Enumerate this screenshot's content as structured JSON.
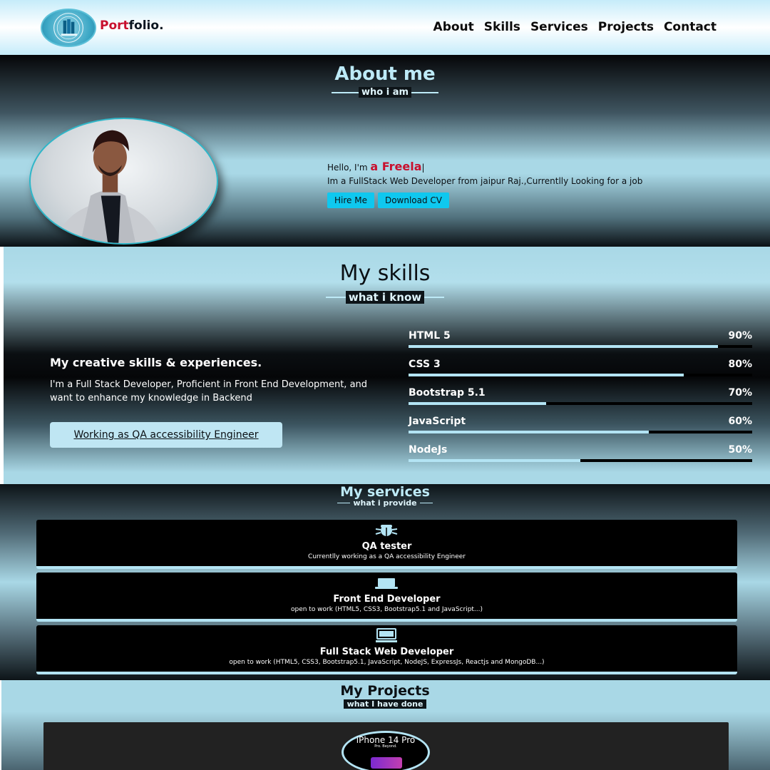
{
  "nav": {
    "brand_part1": "Port",
    "brand_part2": "folio.",
    "links": [
      "About",
      "Skills",
      "Services",
      "Projects",
      "Contact"
    ]
  },
  "about": {
    "title": "About me",
    "subtitle": "who i am",
    "hello": "Hello, I'm ",
    "name": "a Freela",
    "description": "Im a FullStack Web Developer from jaipur Raj.,Currentlly Looking for a job",
    "hire_label": "Hire Me",
    "cv_label": "Download CV"
  },
  "skills": {
    "title": "My skills",
    "subtitle": "what i know",
    "heading": "My creative skills & experiences.",
    "text": "I'm a Full Stack Developer, Proficient in Front End Development, and want to enhance my knowledge in Backend",
    "cta": "Working as QA accessibility Engineer",
    "bars": [
      {
        "name": "HTML 5",
        "pct": "90%",
        "value": 90
      },
      {
        "name": "CSS 3",
        "pct": "80%",
        "value": 80
      },
      {
        "name": "Bootstrap 5.1",
        "pct": "70%",
        "value": 40
      },
      {
        "name": "JavaScript",
        "pct": "60%",
        "value": 70
      },
      {
        "name": "NodeJs",
        "pct": "50%",
        "value": 50
      }
    ]
  },
  "services": {
    "title": "My services",
    "subtitle": "what i provide",
    "items": [
      {
        "icon": "bug-icon",
        "title": "QA tester",
        "desc": "Currentlly working as a QA accessibility Engineer"
      },
      {
        "icon": "laptop-icon",
        "title": "Front End Developer",
        "desc": "open to work (HTML5, CSS3, Bootstrap5.1 and JavaScript...)"
      },
      {
        "icon": "desktop-icon",
        "title": "Full Stack Web Developer",
        "desc": "open to work (HTML5, CSS3, Bootstrap5.1, JavaScript, NodeJS, ExpressJs, Reactjs and MongoDB...)"
      }
    ]
  },
  "projects": {
    "title": "My Projects",
    "subtitle": "what I have done",
    "project_name": "iPhone 14 Pro",
    "project_tag": "Pro. Beyond."
  },
  "colors": {
    "accent_red": "#c8102e",
    "accent_cyan": "#0fc8ef",
    "light_blue": "#b3e4f4"
  }
}
